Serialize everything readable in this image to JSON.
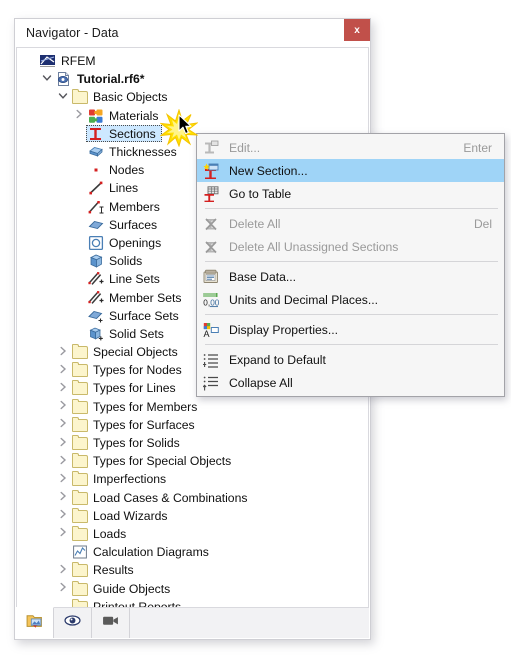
{
  "window": {
    "title": "Navigator - Data",
    "close_label": "x",
    "close_icon": "close-icon"
  },
  "tree": {
    "items": [
      {
        "label": "RFEM",
        "indent": 0,
        "twisty": "",
        "icon": "rfem-logo-icon",
        "bold": false,
        "selected": false
      },
      {
        "label": "Tutorial.rf6*",
        "indent": 1,
        "twisty": "v",
        "icon": "document-icon",
        "bold": true,
        "selected": false
      },
      {
        "label": "Basic Objects",
        "indent": 2,
        "twisty": "v",
        "icon": "folder-icon",
        "bold": false,
        "selected": false
      },
      {
        "label": "Materials",
        "indent": 3,
        "twisty": ">",
        "icon": "materials-icon",
        "bold": false,
        "selected": false
      },
      {
        "label": "Sections",
        "indent": 3,
        "twisty": "",
        "icon": "section-icon",
        "bold": false,
        "selected": true
      },
      {
        "label": "Thicknesses",
        "indent": 3,
        "twisty": "",
        "icon": "thickness-icon",
        "bold": false,
        "selected": false
      },
      {
        "label": "Nodes",
        "indent": 3,
        "twisty": "",
        "icon": "node-icon",
        "bold": false,
        "selected": false
      },
      {
        "label": "Lines",
        "indent": 3,
        "twisty": "",
        "icon": "line-icon",
        "bold": false,
        "selected": false
      },
      {
        "label": "Members",
        "indent": 3,
        "twisty": "",
        "icon": "member-icon",
        "bold": false,
        "selected": false
      },
      {
        "label": "Surfaces",
        "indent": 3,
        "twisty": "",
        "icon": "surface-icon",
        "bold": false,
        "selected": false
      },
      {
        "label": "Openings",
        "indent": 3,
        "twisty": "",
        "icon": "opening-icon",
        "bold": false,
        "selected": false
      },
      {
        "label": "Solids",
        "indent": 3,
        "twisty": "",
        "icon": "solid-icon",
        "bold": false,
        "selected": false
      },
      {
        "label": "Line Sets",
        "indent": 3,
        "twisty": "",
        "icon": "line-set-icon",
        "bold": false,
        "selected": false
      },
      {
        "label": "Member Sets",
        "indent": 3,
        "twisty": "",
        "icon": "member-set-icon",
        "bold": false,
        "selected": false
      },
      {
        "label": "Surface Sets",
        "indent": 3,
        "twisty": "",
        "icon": "surface-set-icon",
        "bold": false,
        "selected": false
      },
      {
        "label": "Solid Sets",
        "indent": 3,
        "twisty": "",
        "icon": "solid-set-icon",
        "bold": false,
        "selected": false
      },
      {
        "label": "Special Objects",
        "indent": 2,
        "twisty": ">",
        "icon": "folder-icon",
        "bold": false,
        "selected": false
      },
      {
        "label": "Types for Nodes",
        "indent": 2,
        "twisty": ">",
        "icon": "folder-icon",
        "bold": false,
        "selected": false
      },
      {
        "label": "Types for Lines",
        "indent": 2,
        "twisty": ">",
        "icon": "folder-icon",
        "bold": false,
        "selected": false
      },
      {
        "label": "Types for Members",
        "indent": 2,
        "twisty": ">",
        "icon": "folder-icon",
        "bold": false,
        "selected": false
      },
      {
        "label": "Types for Surfaces",
        "indent": 2,
        "twisty": ">",
        "icon": "folder-icon",
        "bold": false,
        "selected": false
      },
      {
        "label": "Types for Solids",
        "indent": 2,
        "twisty": ">",
        "icon": "folder-icon",
        "bold": false,
        "selected": false
      },
      {
        "label": "Types for Special Objects",
        "indent": 2,
        "twisty": ">",
        "icon": "folder-icon",
        "bold": false,
        "selected": false
      },
      {
        "label": "Imperfections",
        "indent": 2,
        "twisty": ">",
        "icon": "folder-icon",
        "bold": false,
        "selected": false
      },
      {
        "label": "Load Cases & Combinations",
        "indent": 2,
        "twisty": ">",
        "icon": "folder-icon",
        "bold": false,
        "selected": false
      },
      {
        "label": "Load Wizards",
        "indent": 2,
        "twisty": ">",
        "icon": "folder-icon",
        "bold": false,
        "selected": false
      },
      {
        "label": "Loads",
        "indent": 2,
        "twisty": ">",
        "icon": "folder-icon",
        "bold": false,
        "selected": false
      },
      {
        "label": "Calculation Diagrams",
        "indent": 2,
        "twisty": "",
        "icon": "diagram-icon",
        "bold": false,
        "selected": false
      },
      {
        "label": "Results",
        "indent": 2,
        "twisty": ">",
        "icon": "folder-icon",
        "bold": false,
        "selected": false
      },
      {
        "label": "Guide Objects",
        "indent": 2,
        "twisty": ">",
        "icon": "folder-icon",
        "bold": false,
        "selected": false
      },
      {
        "label": "Printout Reports",
        "indent": 2,
        "twisty": "",
        "icon": "folder-icon",
        "bold": false,
        "selected": false
      }
    ]
  },
  "bottom_bar": {
    "tabs": [
      {
        "name": "data-navigator-tab",
        "icon": "data-navigator-icon",
        "active": true
      },
      {
        "name": "display-navigator-tab",
        "icon": "eye-icon",
        "active": false
      },
      {
        "name": "views-navigator-tab",
        "icon": "camera-icon",
        "active": false
      }
    ]
  },
  "context_menu": {
    "items": [
      {
        "type": "item",
        "label": "Edit...",
        "shortcut": "Enter",
        "icon": "edit-section-icon",
        "disabled": true,
        "highlight": false
      },
      {
        "type": "item",
        "label": "New Section...",
        "shortcut": "",
        "icon": "new-section-icon",
        "disabled": false,
        "highlight": true
      },
      {
        "type": "item",
        "label": "Go to Table",
        "shortcut": "",
        "icon": "go-to-table-icon",
        "disabled": false,
        "highlight": false
      },
      {
        "type": "separator"
      },
      {
        "type": "item",
        "label": "Delete All",
        "shortcut": "Del",
        "icon": "delete-all-icon",
        "disabled": true,
        "highlight": false
      },
      {
        "type": "item",
        "label": "Delete All Unassigned Sections",
        "shortcut": "",
        "icon": "delete-unassigned-icon",
        "disabled": true,
        "highlight": false
      },
      {
        "type": "separator"
      },
      {
        "type": "item",
        "label": "Base Data...",
        "shortcut": "",
        "icon": "base-data-icon",
        "disabled": false,
        "highlight": false
      },
      {
        "type": "item",
        "label": "Units and Decimal Places...",
        "shortcut": "",
        "icon": "units-decimals-icon",
        "disabled": false,
        "highlight": false
      },
      {
        "type": "separator"
      },
      {
        "type": "item",
        "label": "Display Properties...",
        "shortcut": "",
        "icon": "display-properties-icon",
        "disabled": false,
        "highlight": false
      },
      {
        "type": "separator"
      },
      {
        "type": "item",
        "label": "Expand to Default",
        "shortcut": "",
        "icon": "expand-icon",
        "disabled": false,
        "highlight": false
      },
      {
        "type": "item",
        "label": "Collapse All",
        "shortcut": "",
        "icon": "collapse-icon",
        "disabled": false,
        "highlight": false
      }
    ]
  },
  "colors": {
    "selection_blue": "#cde8ff",
    "menu_highlight": "#9fd4f7",
    "close_red": "#c1504a",
    "folder_yellow": "#fcf5cd",
    "accent_red": "#cc2222",
    "window_bg": "#ffffff"
  }
}
